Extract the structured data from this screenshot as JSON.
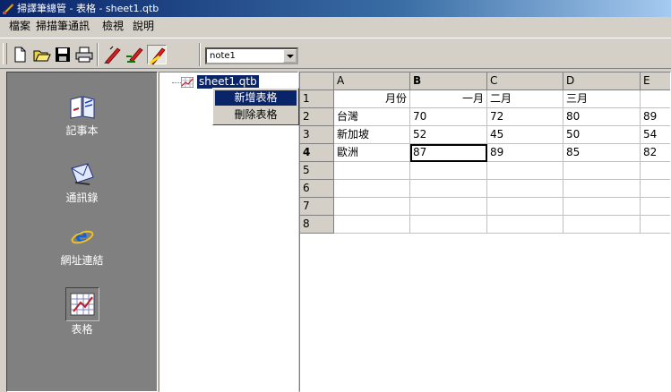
{
  "window": {
    "title": "掃譯筆總管 - 表格 - sheet1.qtb"
  },
  "menu": [
    "檔案",
    "掃描筆通訊",
    "檢視",
    "說明"
  ],
  "toolbar": {
    "buttons": [
      "new-file-icon",
      "open-folder-icon",
      "save-icon",
      "print-icon",
      "pen-red-icon",
      "pen-delete-icon",
      "pen-highlight-icon"
    ],
    "note_select": "note1"
  },
  "sidebar": {
    "items": [
      {
        "label": "記事本",
        "icon": "notebook-icon"
      },
      {
        "label": "通訊錄",
        "icon": "mail-icon"
      },
      {
        "label": "網址連結",
        "icon": "ie-link-icon"
      },
      {
        "label": "表格",
        "icon": "spreadsheet-icon",
        "active": true
      }
    ]
  },
  "tree": {
    "node_label": "sheet1.qtb"
  },
  "context_menu": {
    "items": [
      "新增表格",
      "刪除表格"
    ]
  },
  "sheet": {
    "columns": [
      "A",
      "B",
      "C",
      "D",
      "E"
    ],
    "row_numbers": [
      "1",
      "2",
      "3",
      "4",
      "5",
      "6",
      "7",
      "8"
    ],
    "rows": [
      [
        "月份",
        "一月",
        "二月",
        "三月",
        ""
      ],
      [
        "台灣",
        "70",
        "72",
        "80",
        "89"
      ],
      [
        "新加坡",
        "52",
        "45",
        "50",
        "54"
      ],
      [
        "歐洲",
        "87",
        "89",
        "85",
        "82"
      ],
      [
        "",
        "",
        "",
        "",
        ""
      ],
      [
        "",
        "",
        "",
        "",
        ""
      ],
      [
        "",
        "",
        "",
        "",
        ""
      ],
      [
        "",
        "",
        "",
        "",
        ""
      ]
    ],
    "active_column": "B",
    "active_row": "4"
  }
}
